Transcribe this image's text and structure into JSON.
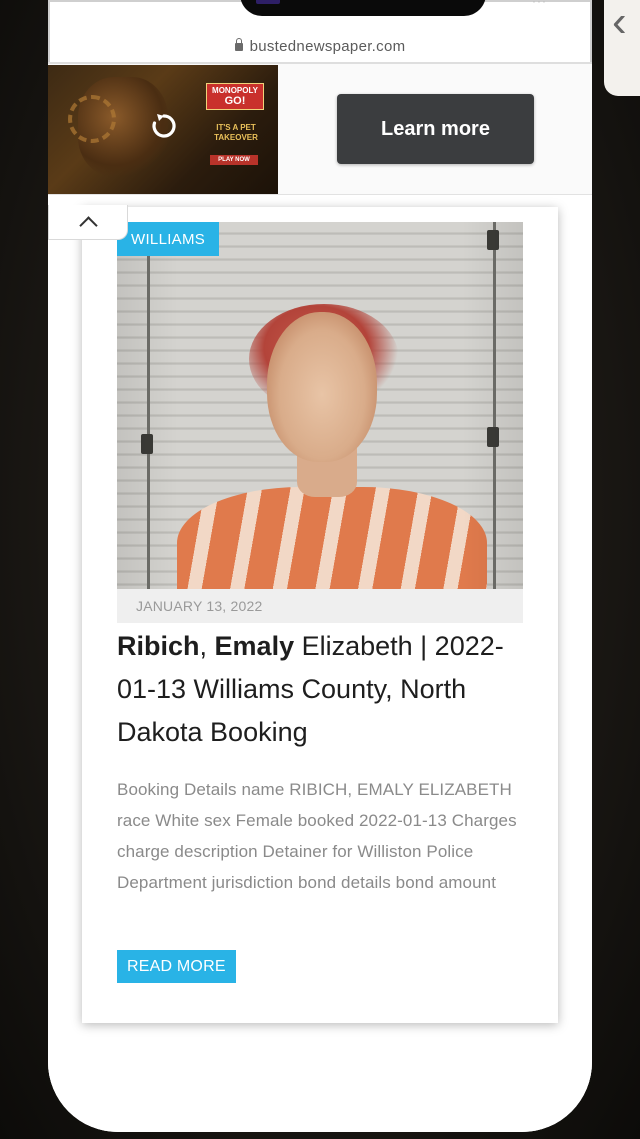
{
  "browser": {
    "url": "bustednewspaper.com"
  },
  "ad": {
    "brand_line1": "MONOPOLY",
    "brand_line2": "GO!",
    "tagline": "IT'S A PET TAKEOVER",
    "cta_small": "PLAY NOW",
    "cta_button": "Learn more"
  },
  "post": {
    "category": "WILLIAMS",
    "date": "JANUARY 13, 2022",
    "title_last": "Ribich",
    "title_sep": ", ",
    "title_first": "Emaly",
    "title_rest": " Elizabeth | 2022-01-13 Williams County, North Dakota Booking",
    "excerpt": "Booking Details name RIBICH, EMALY ELIZABETH race White sex Female booked 2022-01-13 Charges charge description Detainer for Williston Police Department jurisdiction bond details bond amount",
    "read_more": "READ MORE"
  },
  "colors": {
    "accent": "#29b3e6",
    "ad_button": "#3b3d3f"
  },
  "icons": {
    "lock": "lock-icon",
    "replay": "replay-icon",
    "collapse": "chevron-up-icon",
    "back": "chevron-left-icon"
  }
}
